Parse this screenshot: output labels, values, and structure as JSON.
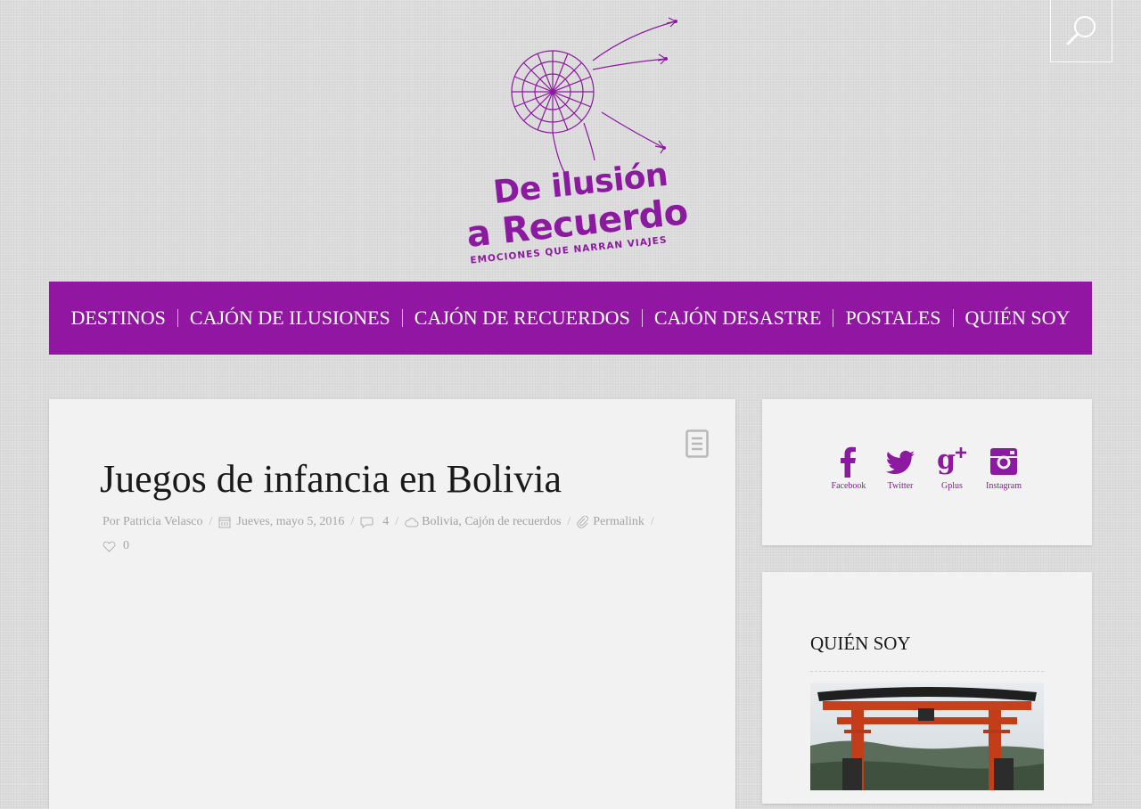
{
  "brand": {
    "line1": "De ilusión",
    "line2": "a Recuerdo",
    "tagline": "EMOCIONES QUE NARRAN VIAJES",
    "color": "#8b1aa0"
  },
  "search": {
    "icon": "search-icon"
  },
  "nav": {
    "color": "#9117a3",
    "items": [
      {
        "label": "DESTINOS"
      },
      {
        "label": "CAJÓN DE ILUSIONES"
      },
      {
        "label": "CAJÓN DE RECUERDOS"
      },
      {
        "label": "CAJÓN DESASTRE"
      },
      {
        "label": "POSTALES"
      },
      {
        "label": "QUIÉN SOY"
      }
    ]
  },
  "post": {
    "format_icon": "document-icon",
    "title": "Juegos de infancia en Bolivia",
    "author": "Por Patricia Velasco",
    "date": "Jueves, mayo 5, 2016",
    "comments": "4",
    "categories": "Bolivia, Cajón de recuerdos",
    "permalink": "Permalink",
    "likes": "0"
  },
  "social": {
    "items": [
      {
        "label": "Facebook",
        "icon": "facebook-icon"
      },
      {
        "label": "Twitter",
        "icon": "twitter-icon"
      },
      {
        "label": "Gplus",
        "icon": "google-plus-icon"
      },
      {
        "label": "Instagram",
        "icon": "instagram-icon"
      }
    ]
  },
  "about": {
    "title": "QUIÉN SOY"
  }
}
